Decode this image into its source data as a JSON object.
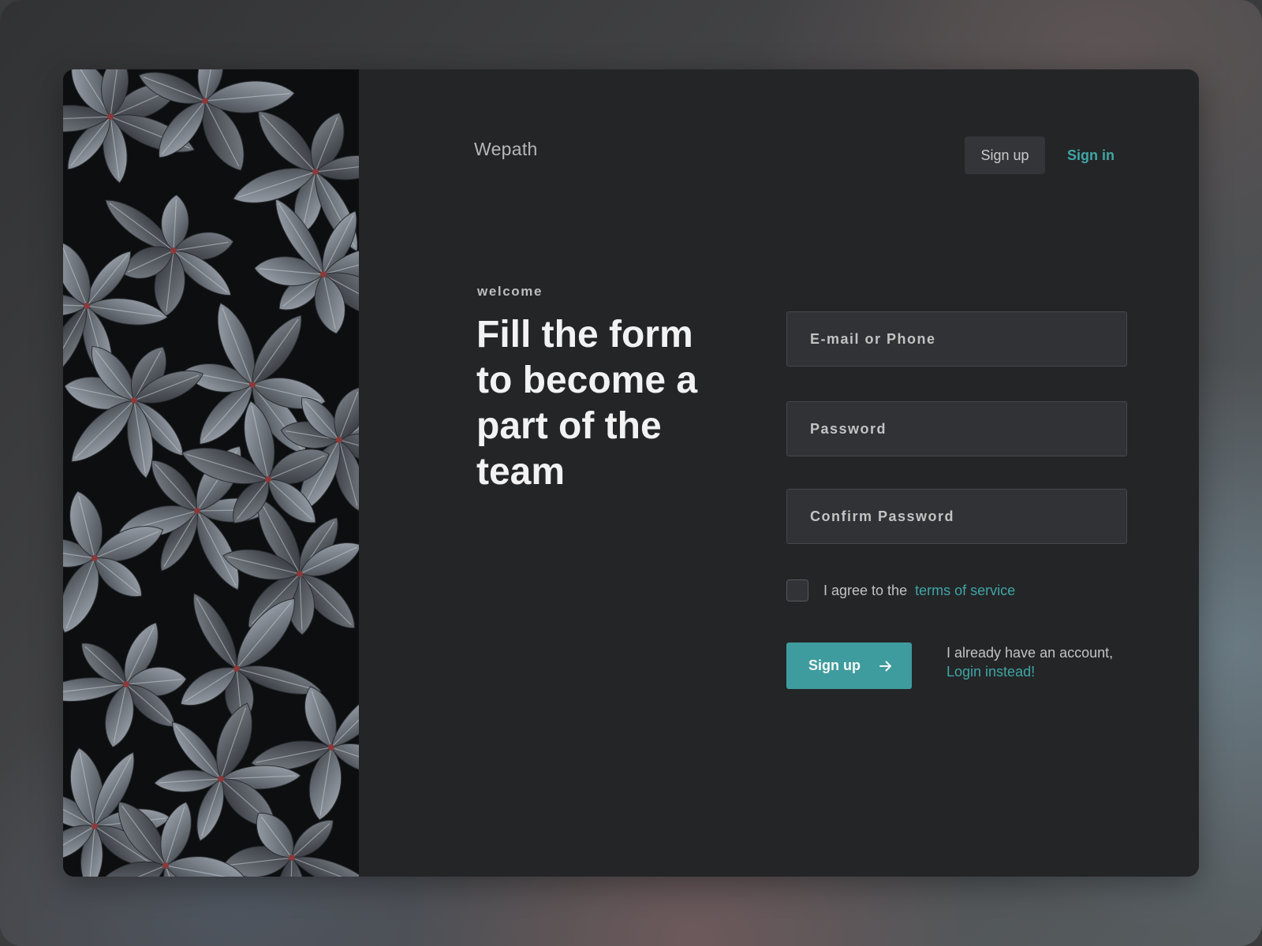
{
  "brand": {
    "name": "Wepath"
  },
  "nav": {
    "signup_label": "Sign up",
    "signin_label": "Sign in"
  },
  "intro": {
    "eyebrow": "welcome",
    "headline": "Fill the form to become a part of the team"
  },
  "form": {
    "email_placeholder": "E-mail or Phone",
    "password_placeholder": "Password",
    "confirm_placeholder": "Confirm Password",
    "agree_text": "I agree to the",
    "terms_link": "terms of service",
    "submit_label": "Sign up",
    "already_text": "I already have an account,",
    "login_link": "Login instead!"
  },
  "colors": {
    "accent": "#3fa6a6",
    "card_bg": "#242527",
    "field_bg": "#313235",
    "button_bg": "#3f9c9e"
  },
  "icons": {
    "submit_icon": "arrow-right-icon"
  }
}
